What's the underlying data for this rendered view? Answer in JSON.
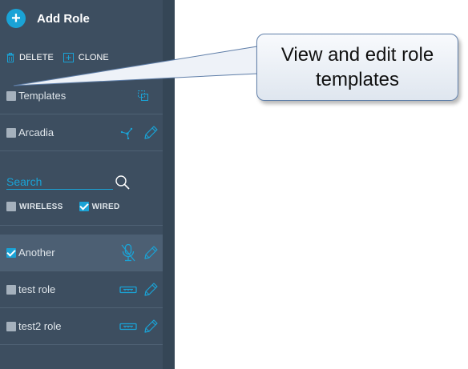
{
  "sidebar": {
    "add_role_label": "Add Role",
    "add_symbol": "+",
    "delete_label": "DELETE",
    "clone_label": "CLONE",
    "templates_label": "Templates",
    "arcadia_label": "Arcadia",
    "search": {
      "placeholder": "Search",
      "value": ""
    },
    "filters": {
      "wireless": {
        "label": "WIRELESS",
        "checked": false
      },
      "wired": {
        "label": "WIRED",
        "checked": true
      }
    },
    "roles": [
      {
        "label": "Another",
        "checked": true,
        "selected": true,
        "icon": "mic-off-icon"
      },
      {
        "label": "test role",
        "checked": false,
        "selected": false,
        "icon": "ethernet-port-icon"
      },
      {
        "label": "test2 role",
        "checked": false,
        "selected": false,
        "icon": "ethernet-port-icon"
      }
    ]
  },
  "callout": {
    "line1": "View and edit role",
    "line2": "templates"
  },
  "colors": {
    "sidebar": "#3d4e60",
    "accent": "#1aa3d6",
    "selected_row": "#4c5f73"
  }
}
